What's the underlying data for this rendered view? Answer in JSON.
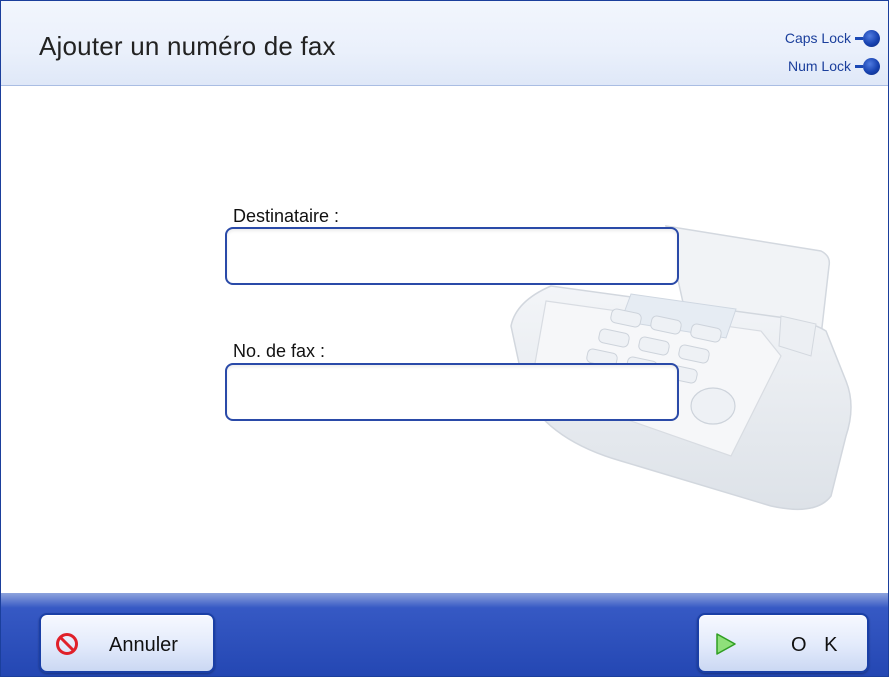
{
  "header": {
    "title": "Ajouter un numéro de fax",
    "indicators": [
      {
        "label": "Caps Lock",
        "state": "on"
      },
      {
        "label": "Num Lock",
        "state": "on"
      }
    ]
  },
  "form": {
    "recipient_label": "Destinataire :",
    "recipient_value": "",
    "fax_label": "No. de fax :",
    "fax_value": ""
  },
  "footer": {
    "cancel_label": "Annuler",
    "ok_label": "O K",
    "cancel_icon": "prohibited-icon",
    "ok_icon": "play-arrow-icon"
  },
  "colors": {
    "accent": "#1b3f9c",
    "footer": "#2447b3",
    "cancel_icon": "#e0202a",
    "ok_icon": "#3fbf2a"
  }
}
